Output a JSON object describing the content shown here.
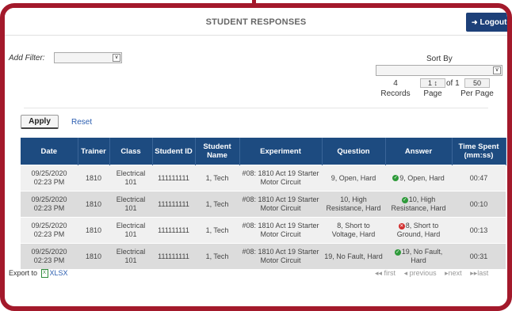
{
  "header": {
    "title": "STUDENT RESPONSES",
    "logout_label": "Logout"
  },
  "filter": {
    "label": "Add Filter:",
    "selected": ""
  },
  "sort": {
    "label": "Sort By",
    "selected": ""
  },
  "pager": {
    "records": "4",
    "records_label": "Records",
    "page": "1",
    "of_label": "of 1",
    "page_label": "Page",
    "per_page": "50",
    "per_page_label": "Per Page"
  },
  "actions": {
    "apply_label": "Apply",
    "reset_label": "Reset"
  },
  "table": {
    "headers": [
      "Date",
      "Trainer",
      "Class",
      "Student ID",
      "Student Name",
      "Experiment",
      "Question",
      "Answer",
      "Time Spent (mm:ss)"
    ],
    "rows": [
      {
        "date": "09/25/2020 02:23 PM",
        "trainer": "1810",
        "class": "Electrical 101",
        "student_id": "111111111",
        "student_name": "1, Tech",
        "experiment": "#08: 1810 Act 19 Starter Motor Circuit",
        "question": "9, Open, Hard",
        "answer": "9, Open, Hard",
        "correct": true,
        "time": "00:47"
      },
      {
        "date": "09/25/2020 02:23 PM",
        "trainer": "1810",
        "class": "Electrical 101",
        "student_id": "111111111",
        "student_name": "1, Tech",
        "experiment": "#08: 1810 Act 19 Starter Motor Circuit",
        "question": "10, High Resistance, Hard",
        "answer": "10, High Resistance, Hard",
        "correct": true,
        "time": "00:10"
      },
      {
        "date": "09/25/2020 02:23 PM",
        "trainer": "1810",
        "class": "Electrical 101",
        "student_id": "111111111",
        "student_name": "1, Tech",
        "experiment": "#08: 1810 Act 19 Starter Motor Circuit",
        "question": "8, Short to Voltage, Hard",
        "answer": "8, Short to Ground, Hard",
        "correct": false,
        "time": "00:13"
      },
      {
        "date": "09/25/2020 02:23 PM",
        "trainer": "1810",
        "class": "Electrical 101",
        "student_id": "111111111",
        "student_name": "1, Tech",
        "experiment": "#08: 1810 Act 19 Starter Motor Circuit",
        "question": "19, No Fault, Hard",
        "answer": "19, No Fault, Hard",
        "correct": true,
        "time": "00:31"
      }
    ]
  },
  "export": {
    "label": "Export to",
    "format": "XLSX"
  },
  "pagination": {
    "first": "first",
    "previous": "previous",
    "next": "next",
    "last": "last"
  },
  "colors": {
    "frame": "#a3192b",
    "header_bg": "#1d4b80",
    "logout_bg": "#1d4079",
    "correct": "#2e9a3a",
    "incorrect": "#d23030"
  }
}
